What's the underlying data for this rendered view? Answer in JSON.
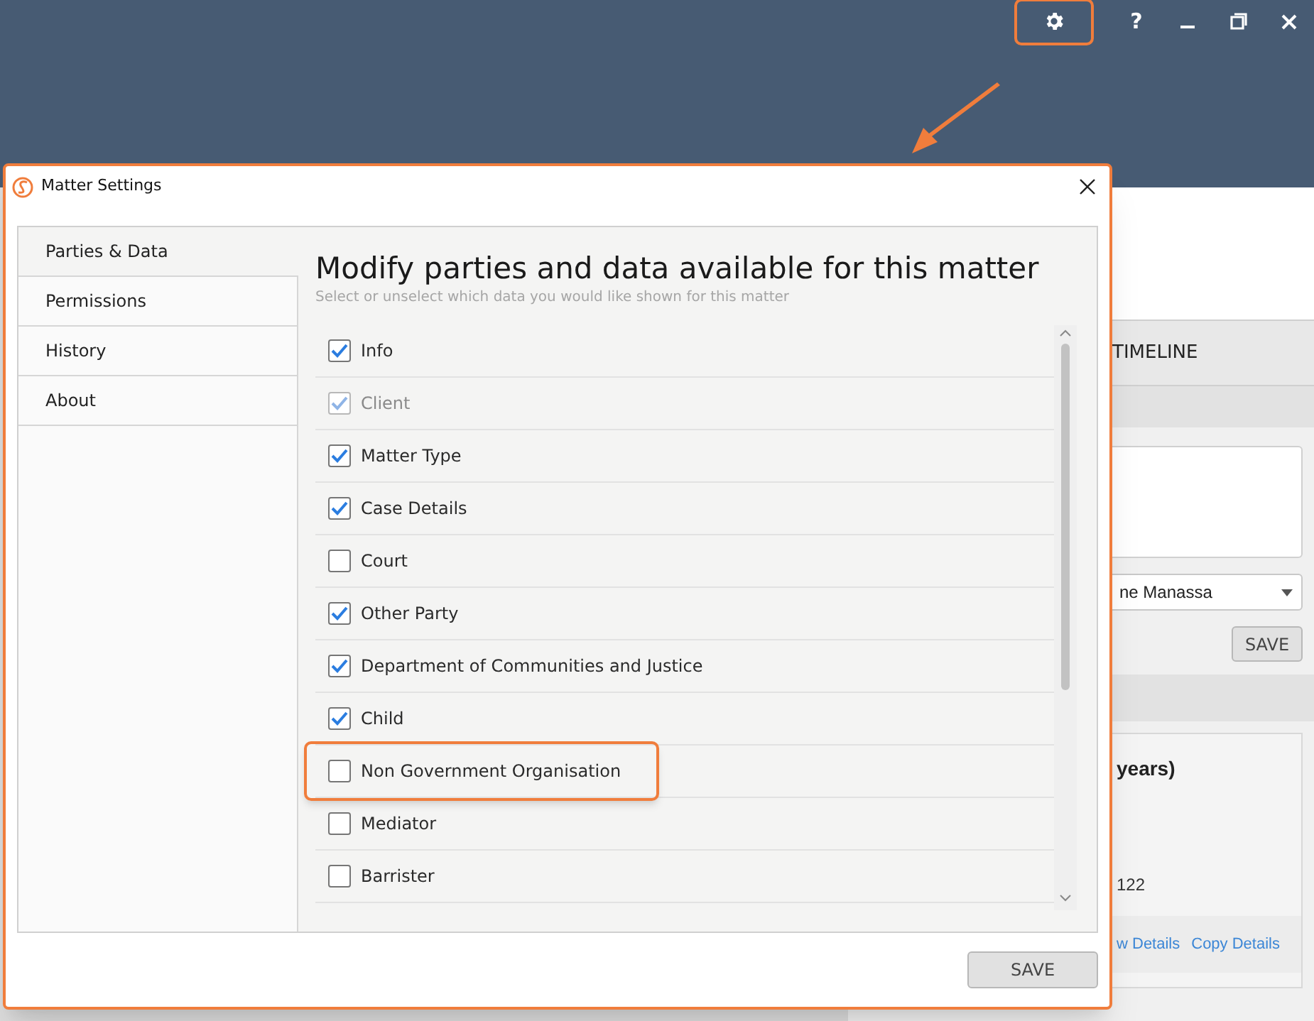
{
  "app_toolbar": {
    "settings_highlighted": true,
    "help": "?"
  },
  "background": {
    "tab": "TIMELINE",
    "dropdown_value": "ne Manassa",
    "save": "SAVE",
    "card_title": "years)",
    "card_line": "122",
    "links": [
      "w Details",
      "Copy Details"
    ]
  },
  "dialog": {
    "title": "Matter Settings",
    "sidebar": [
      {
        "label": "Parties & Data",
        "selected": true
      },
      {
        "label": "Permissions",
        "selected": false
      },
      {
        "label": "History",
        "selected": false
      },
      {
        "label": "About",
        "selected": false
      }
    ],
    "heading": "Modify parties and data available for this matter",
    "subheading": "Select or unselect which data you would like shown for this matter",
    "items": [
      {
        "label": "Info",
        "checked": true,
        "disabled": false,
        "highlighted": false
      },
      {
        "label": "Client",
        "checked": true,
        "disabled": true,
        "highlighted": false
      },
      {
        "label": "Matter Type",
        "checked": true,
        "disabled": false,
        "highlighted": false
      },
      {
        "label": "Case Details",
        "checked": true,
        "disabled": false,
        "highlighted": false
      },
      {
        "label": "Court",
        "checked": false,
        "disabled": false,
        "highlighted": false
      },
      {
        "label": "Other Party",
        "checked": true,
        "disabled": false,
        "highlighted": false
      },
      {
        "label": "Department of Communities and Justice",
        "checked": true,
        "disabled": false,
        "highlighted": false
      },
      {
        "label": "Child",
        "checked": true,
        "disabled": false,
        "highlighted": false
      },
      {
        "label": "Non Government Organisation",
        "checked": false,
        "disabled": false,
        "highlighted": true
      },
      {
        "label": "Mediator",
        "checked": false,
        "disabled": false,
        "highlighted": false
      },
      {
        "label": "Barrister",
        "checked": false,
        "disabled": false,
        "highlighted": false
      }
    ],
    "save": "SAVE"
  }
}
